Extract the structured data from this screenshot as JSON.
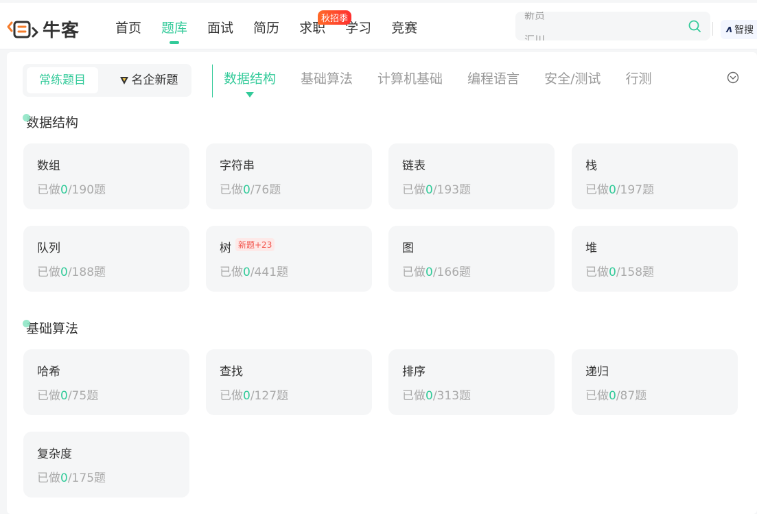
{
  "header": {
    "logo_text": "牛客",
    "nav": [
      {
        "label": "首页",
        "active": false
      },
      {
        "label": "题库",
        "active": true
      },
      {
        "label": "面试",
        "active": false
      },
      {
        "label": "简历",
        "active": false
      },
      {
        "label": "求职",
        "active": false
      },
      {
        "label": "学习",
        "active": false
      },
      {
        "label": "竞赛",
        "active": false
      }
    ],
    "badge": "秋招季",
    "search_hot_1": "新员",
    "search_hot_2": "汇川",
    "zhisou_label": "智搜"
  },
  "segment": {
    "option1": "常练题目",
    "option2": "名企新题"
  },
  "tabs": [
    {
      "label": "数据结构",
      "active": true
    },
    {
      "label": "基础算法",
      "active": false
    },
    {
      "label": "计算机基础",
      "active": false
    },
    {
      "label": "编程语言",
      "active": false
    },
    {
      "label": "安全/测试",
      "active": false
    },
    {
      "label": "行测",
      "active": false
    }
  ],
  "sections": [
    {
      "title": "数据结构",
      "cards": [
        {
          "name": "数组",
          "done_prefix": "已做",
          "done": "0",
          "total": "/190题"
        },
        {
          "name": "字符串",
          "done_prefix": "已做",
          "done": "0",
          "total": "/76题"
        },
        {
          "name": "链表",
          "done_prefix": "已做",
          "done": "0",
          "total": "/193题"
        },
        {
          "name": "栈",
          "done_prefix": "已做",
          "done": "0",
          "total": "/197题"
        },
        {
          "name": "队列",
          "done_prefix": "已做",
          "done": "0",
          "total": "/188题"
        },
        {
          "name": "树",
          "done_prefix": "已做",
          "done": "0",
          "total": "/441题",
          "new_tag": "新题+23"
        },
        {
          "name": "图",
          "done_prefix": "已做",
          "done": "0",
          "total": "/166题"
        },
        {
          "name": "堆",
          "done_prefix": "已做",
          "done": "0",
          "total": "/158题"
        }
      ]
    },
    {
      "title": "基础算法",
      "cards": [
        {
          "name": "哈希",
          "done_prefix": "已做",
          "done": "0",
          "total": "/75题"
        },
        {
          "name": "查找",
          "done_prefix": "已做",
          "done": "0",
          "total": "/127题"
        },
        {
          "name": "排序",
          "done_prefix": "已做",
          "done": "0",
          "total": "/313题"
        },
        {
          "name": "递归",
          "done_prefix": "已做",
          "done": "0",
          "total": "/87题"
        },
        {
          "name": "复杂度",
          "done_prefix": "已做",
          "done": "0",
          "total": "/175题"
        }
      ]
    }
  ],
  "colors": {
    "accent": "#32ca99",
    "muted": "#aaaaaa",
    "card_bg": "#f5f6f7",
    "badge": "#ff4d2a",
    "new_tag": "#f2554d"
  }
}
